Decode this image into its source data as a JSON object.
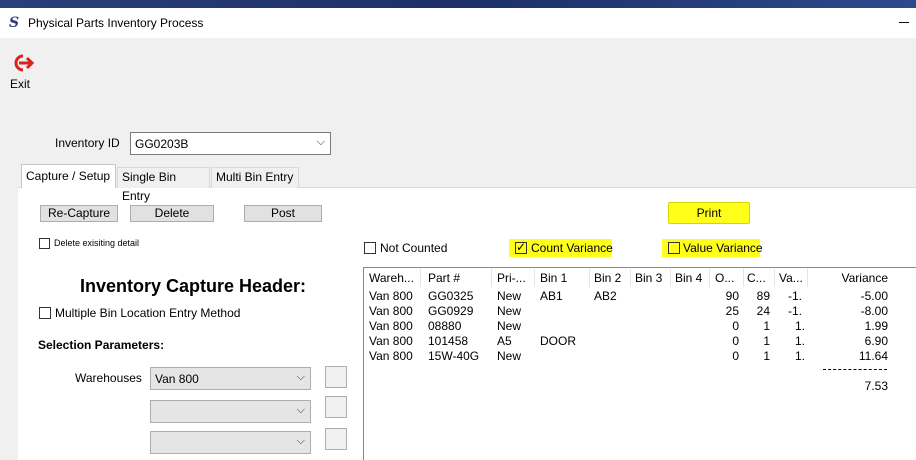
{
  "window": {
    "title": "Physical Parts Inventory Process"
  },
  "toolbar": {
    "exit_label": "Exit"
  },
  "inventory": {
    "label": "Inventory ID",
    "value": "GG0203B"
  },
  "tabs": [
    "Capture / Setup",
    "Single Bin Entry",
    "Multi Bin Entry"
  ],
  "buttons": {
    "recapture": "Re-Capture",
    "delete": "Delete",
    "post": "Post",
    "print": "Print"
  },
  "options": {
    "delete_existing": "Delete exisiting detail",
    "multiple_bin": "Multiple Bin Location Entry Method",
    "not_counted": "Not Counted",
    "count_variance": "Count Variance",
    "value_variance": "Value Variance"
  },
  "header": {
    "title": "Inventory Capture Header:"
  },
  "selection": {
    "title": "Selection Parameters:",
    "warehouses_label": "Warehouses",
    "warehouse_value": "Van 800"
  },
  "grid": {
    "columns": [
      "Wareh...",
      "Part #",
      "Pri-...",
      "Bin 1",
      "Bin 2",
      "Bin 3",
      "Bin 4",
      "O...",
      "C...",
      "Va...",
      "Variance"
    ],
    "rows": [
      [
        "Van 800",
        "GG0325",
        "New",
        "AB1",
        "AB2",
        "",
        "",
        "90",
        "89",
        "-1.",
        "-5.00"
      ],
      [
        "Van 800",
        "GG0929",
        "New",
        "",
        "",
        "",
        "",
        "25",
        "24",
        "-1.",
        "-8.00"
      ],
      [
        "Van 800",
        "08880",
        "New",
        "",
        "",
        "",
        "",
        "0",
        "1",
        "1.",
        "1.99"
      ],
      [
        "Van 800",
        "101458",
        "A5",
        "DOOR",
        "",
        "",
        "",
        "0",
        "1",
        "1.",
        "6.90"
      ],
      [
        "Van 800",
        "15W-40G",
        "New",
        "",
        "",
        "",
        "",
        "0",
        "1",
        "1.",
        "11.64"
      ]
    ],
    "total": "7.53"
  },
  "colors": {
    "highlight": "#ffff1a",
    "title_strip": "#2a3f7a",
    "exit_red": "#d9231d"
  },
  "icons": {
    "app": "app-logo-icon",
    "exit": "exit-icon"
  }
}
